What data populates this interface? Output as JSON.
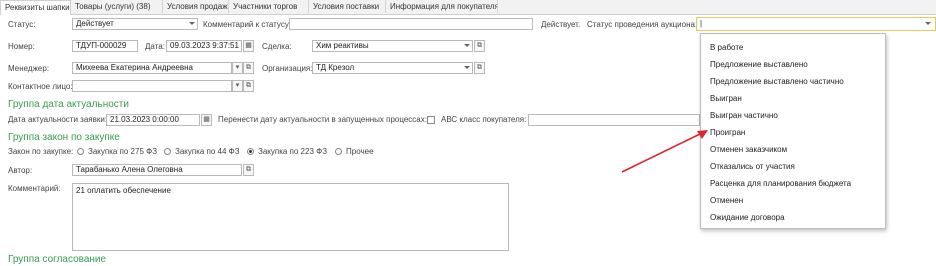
{
  "tabs": [
    {
      "label": "Реквизиты шапки"
    },
    {
      "label": "Товары (услуги) (38)"
    },
    {
      "label": "Условия продажи"
    },
    {
      "label": "Участники торгов"
    },
    {
      "label": "Условия поставки"
    },
    {
      "label": "Информация для покупателя"
    }
  ],
  "row1": {
    "status_label": "Статус:",
    "status_value": "Действует",
    "comment_label": "Комментарий к статусу:",
    "comment_value": "",
    "status_short": "Действует.",
    "auction_label": "Статус проведения аукциона:",
    "auction_value": "|"
  },
  "row2": {
    "number_label": "Номер:",
    "number_value": "ТДУП-000029",
    "date_label": "Дата:",
    "date_value": "09.03.2023  9:37:51",
    "deal_label": "Сделка:",
    "deal_value": "Хим реактивы"
  },
  "row3": {
    "manager_label": "Менеджер:",
    "manager_value": "Михеева Екатерина Андреевна",
    "org_label": "Организация:",
    "org_value": "ТД Крезол"
  },
  "row4": {
    "contact_label": "Контактное лицо:",
    "contact_value": ""
  },
  "group_actuality": {
    "title": "Группа дата актуальности",
    "date_label": "Дата актуальности заявки:",
    "date_value": "21.03.2023  0:00:00",
    "move_label": "Перенести дату актуальности в запущенных процессах:",
    "abc_label": "АВС класс покупателя:",
    "abc_value": ""
  },
  "group_law": {
    "title": "Группа закон по закупке",
    "law_label": "Закон по закупке:",
    "options": [
      {
        "label": "Закупка по 275 ФЗ",
        "selected": false
      },
      {
        "label": "Закупка по 44 ФЗ",
        "selected": false
      },
      {
        "label": "Закупка по 223 ФЗ",
        "selected": true
      },
      {
        "label": "Прочее",
        "selected": false
      }
    ]
  },
  "author": {
    "label": "Автор:",
    "value": "Тарабанько Алена Олеговна"
  },
  "comment": {
    "label": "Комментарий:",
    "value": "21 оплатить обеспечение"
  },
  "next_group": {
    "title": "Группа согласование"
  },
  "dropdown": {
    "items": [
      "В работе",
      "Предложение выставлено",
      "Предложение выставлено частично",
      "Выигран",
      "Выигран частично",
      "Проигран",
      "Отменен заказчиком",
      "Отказались от участия",
      "Расценка для планирования бюджета",
      "Отменен",
      "Ожидание договора"
    ]
  },
  "colors": {
    "group_title": "#3a9b52",
    "arrow": "#d9272e",
    "highlight_border": "#e8c75a"
  }
}
